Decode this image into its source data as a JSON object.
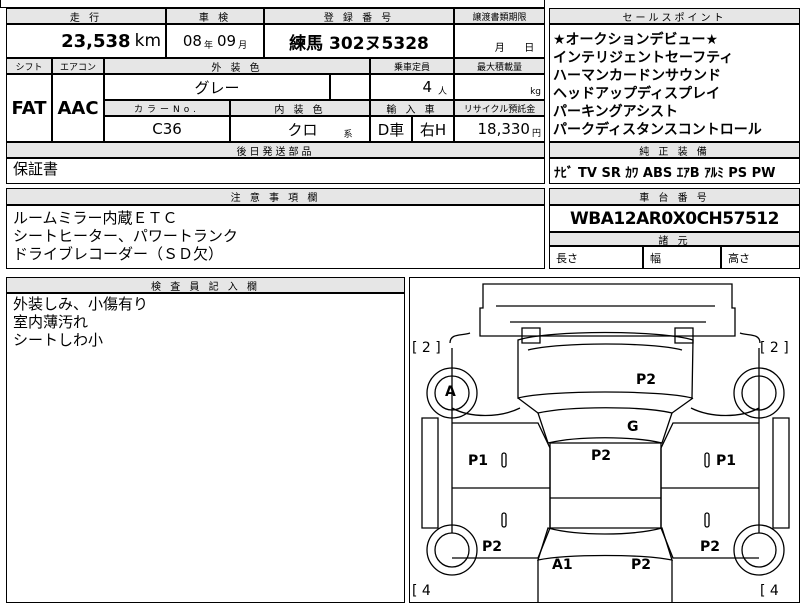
{
  "headers": {
    "mileage": "走 行",
    "inspection": "車 検",
    "registration": "登 録 番 号",
    "transfer_deadline": "譲渡書類期限",
    "sales_points": "セールスポイント",
    "shift": "シフト",
    "aircon": "エアコン",
    "exterior_color": "外 装 色",
    "capacity": "乗車定員",
    "max_load": "最大積載量",
    "color_no": "カラーNo.",
    "interior_color": "内 装 色",
    "import": "輸 入 車",
    "recycle": "リサイクル預託金",
    "deferred_parts": "後日発送部品",
    "genuine_equipment": "純 正 装 備",
    "notes": "注 意 事 項 欄",
    "chassis_no": "車 台 番 号",
    "dimensions": "諸 元",
    "inspector": "検 査 員 記 入 欄"
  },
  "vehicle": {
    "mileage": "23,538",
    "mileage_unit": "km",
    "inspection_year": "08",
    "year_unit": "年",
    "inspection_month": "09",
    "month_unit": "月",
    "plate": "練馬 302ヌ5328",
    "deadline_month": "月",
    "deadline_day": "日",
    "shift": "FAT",
    "aircon": "AAC",
    "exterior_color": "グレー",
    "capacity": "4",
    "capacity_unit": "人",
    "load_unit": "kg",
    "color_no": "C36",
    "interior_color": "クロ",
    "interior_suffix": "系",
    "import_drive": "D車",
    "import_side": "右H",
    "recycle_fee": "18,330",
    "recycle_unit": "円",
    "chassis_no": "WBA12AR0X0CH57512"
  },
  "sales_points": [
    "★オークションデビュー★",
    "インテリジェントセーフティ",
    "ハーマンカードンサウンド",
    "ヘッドアップディスプレイ",
    "パーキングアシスト",
    "パークディスタンスコントロール"
  ],
  "equipment": "ﾅﾋﾞ TV SR ｶﾜ ABS ｴｱB ｱﾙﾐ PS PW",
  "deferred_parts": [
    "保証書"
  ],
  "notes": [
    "ルームミラー内蔵ＥＴＣ",
    "シートヒーター、パワートランク",
    "ドライブレコーダー（ＳＤ欠）"
  ],
  "dimensions": {
    "length": "長さ",
    "width": "幅",
    "height": "高さ"
  },
  "inspector_notes": [
    "外装しみ、小傷有り",
    "室内薄汚れ",
    "シートしわ小"
  ],
  "diagram": {
    "left_front_count": "[ 2 ]",
    "right_front_count": "[ 2 ]",
    "left_rear_count": "[ 4",
    "right_rear_count": "[ 4",
    "marks": {
      "hood": "P2",
      "left_front_tire": "A",
      "windshield": "G",
      "roof": "P2",
      "left_door": "P1",
      "right_door": "P1",
      "left_rear": "P2",
      "right_rear": "P2",
      "rear_left": "A1",
      "rear_right": "P2"
    }
  }
}
